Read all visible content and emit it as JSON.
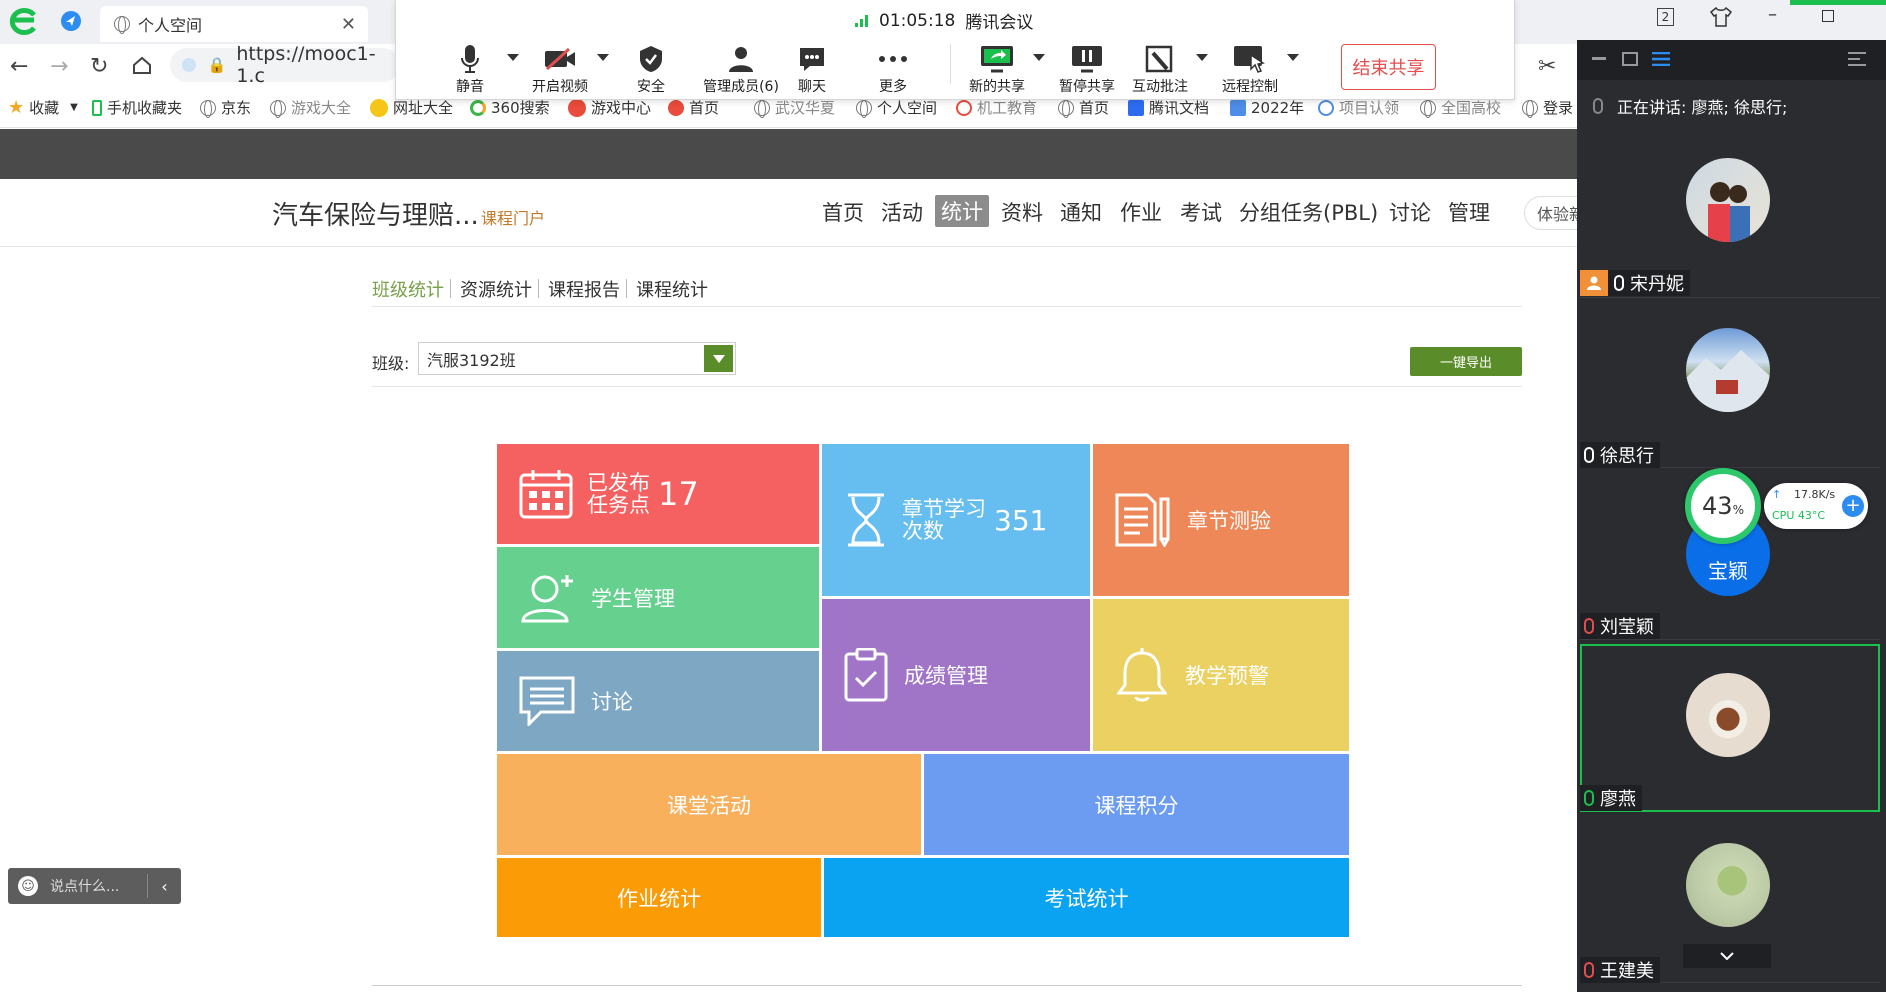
{
  "browser": {
    "tab_title": "个人空间",
    "address": "https://mooc1-1.c",
    "bookmarks": [
      "收藏",
      "手机收藏夹",
      "京东",
      "游戏大全",
      "网址大全",
      "360搜索",
      "游戏中心",
      "首页",
      "武汉华夏",
      "个人空间",
      "机工教育",
      "首页",
      "腾讯文档",
      "2022年",
      "项目认领",
      "全国高校",
      "登录"
    ],
    "tab_count": "2"
  },
  "meeting": {
    "timer": "01:05:18",
    "app_name": "腾讯会议",
    "tools": {
      "mute": "静音",
      "video": "开启视频",
      "security": "安全",
      "members": "管理成员(6)",
      "chat": "聊天",
      "more": "更多",
      "new_share": "新的共享",
      "pause_share": "暂停共享",
      "annotate": "互动批注",
      "remote": "远程控制"
    },
    "end_share": "结束共享",
    "speaking": "正在讲话: 廖燕; 徐思行;",
    "participants": [
      "宋丹妮",
      "徐思行",
      "刘莹颖",
      "廖燕",
      "王建美"
    ],
    "partial_avatar_text": "宝颖",
    "net_speed": "17.8K/s",
    "cpu": "CPU 43°C",
    "cpu_percent": "43",
    "percent_sign": "%"
  },
  "course": {
    "title": "汽车保险与理赔...",
    "portal_link": "课程门户",
    "nav": [
      "首页",
      "活动",
      "统计",
      "资料",
      "通知",
      "作业",
      "考试",
      "分组任务(PBL)",
      "讨论",
      "管理"
    ],
    "nav_active_index": 2,
    "experience_btn": "体验新",
    "subtabs": [
      "班级统计",
      "资源统计",
      "课程报告",
      "课程统计"
    ],
    "class_label": "班级:",
    "class_value": "汽服3192班",
    "export_btn": "一键导出",
    "tiles": {
      "published_line1": "已发布",
      "published_line2": "任务点",
      "published_count": "17",
      "chapter_line1": "章节学习",
      "chapter_line2": "次数",
      "chapter_count": "351",
      "quiz": "章节测验",
      "students": "学生管理",
      "grades": "成绩管理",
      "warning": "教学预警",
      "discussion": "讨论",
      "activity": "课堂活动",
      "points": "课程积分",
      "homework": "作业统计",
      "exam": "考试统计"
    },
    "chat_placeholder": "说点什么..."
  },
  "colors": {
    "red": "#f46160",
    "blue_light": "#66bdf0",
    "orange": "#ee8859",
    "green": "#66d08e",
    "purple": "#a075c8",
    "yellow": "#ebd062",
    "steel": "#7ea7c4",
    "orange_light": "#f8b05d",
    "blue": "#6b9cf2",
    "orange_dark": "#fb9b05",
    "sky": "#0aa3f2",
    "accent_green": "#5b8c2a"
  }
}
